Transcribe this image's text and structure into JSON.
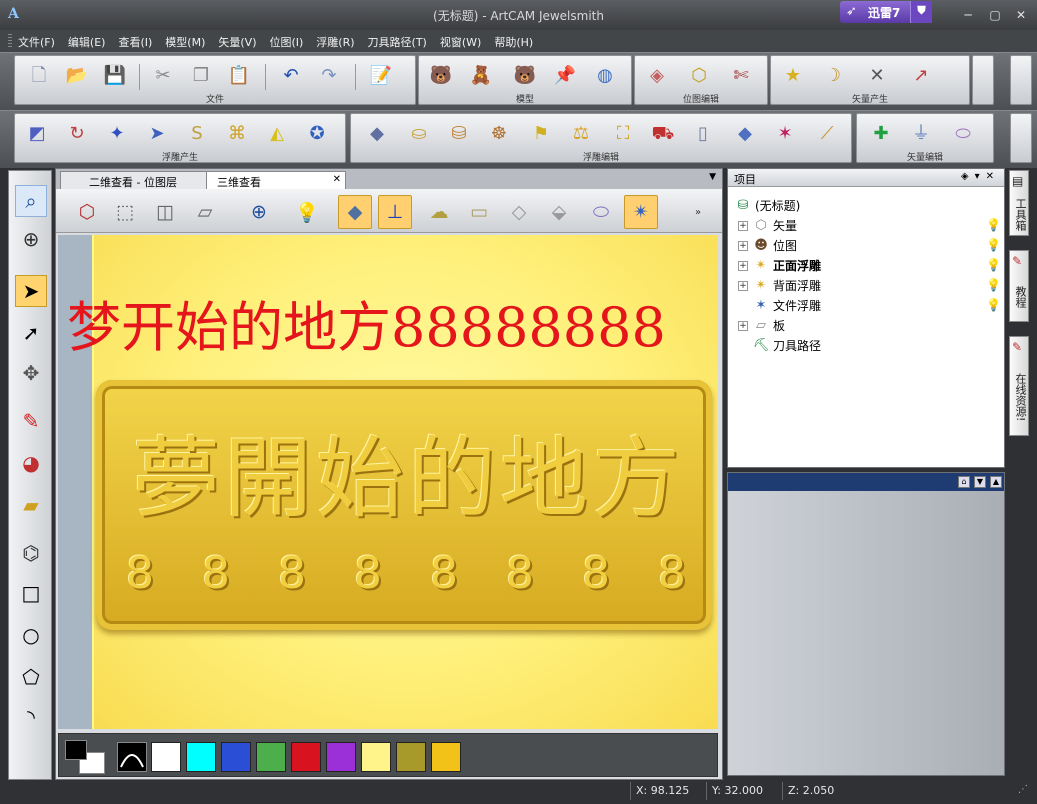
{
  "window": {
    "title": "(无标题) - ArtCAM Jewelsmith",
    "app_icon": "A",
    "minimize": "─",
    "maximize": "▢",
    "close": "✕"
  },
  "xunlei": {
    "label": "迅雷7"
  },
  "menu": [
    "文件(F)",
    "编辑(E)",
    "查看(I)",
    "模型(M)",
    "矢量(V)",
    "位图(I)",
    "浮雕(R)",
    "刀具路径(T)",
    "视窗(W)",
    "帮助(H)"
  ],
  "toolbar1": {
    "captions": [
      "文件",
      "模型",
      "位图编辑",
      "矢量产生"
    ]
  },
  "toolbar2": {
    "captions": [
      "浮雕产生",
      "浮雕编辑",
      "矢量编辑"
    ]
  },
  "tabs": [
    {
      "label": "二维查看 - 位图层"
    },
    {
      "label": "三维查看"
    }
  ],
  "canvas": {
    "red_text": "梦开始的地方88888888",
    "plaque_chars": "夢開始的地方",
    "plaque_nums": [
      "8",
      "8",
      "8",
      "8",
      "8",
      "8",
      "8",
      "8"
    ]
  },
  "palette": {
    "colors": [
      "#ffffff",
      "#00ffff",
      "#2a4fd6",
      "#4caf4c",
      "#d8121e",
      "#9b30d8",
      "#fff48a",
      "#a89a2a",
      "#f2c218"
    ]
  },
  "project": {
    "title": "项目",
    "root": "(无标题)",
    "items": [
      {
        "label": "矢量",
        "icon": "vector-icon",
        "bold": false,
        "expandable": true
      },
      {
        "label": "位图",
        "icon": "bitmap-icon",
        "bold": false,
        "expandable": true
      },
      {
        "label": "正面浮雕",
        "icon": "relief-front-icon",
        "bold": true,
        "expandable": true
      },
      {
        "label": "背面浮雕",
        "icon": "relief-back-icon",
        "bold": false,
        "expandable": true
      },
      {
        "label": "文件浮雕",
        "icon": "file-relief-icon",
        "bold": false,
        "expandable": false
      },
      {
        "label": "板",
        "icon": "board-icon",
        "bold": false,
        "expandable": true
      },
      {
        "label": "刀具路径",
        "icon": "toolpath-icon",
        "bold": false,
        "expandable": false
      }
    ]
  },
  "sidetabs": [
    "工具箱",
    "教程",
    "在线资源!"
  ],
  "status": {
    "x": "X: 98.125",
    "y": "Y: 32.000",
    "z": "Z: 2.050"
  },
  "colors": {
    "relief_gold": "#e0b830",
    "canvas_yellow": "#fff48a",
    "red_text": "#e4161b"
  }
}
